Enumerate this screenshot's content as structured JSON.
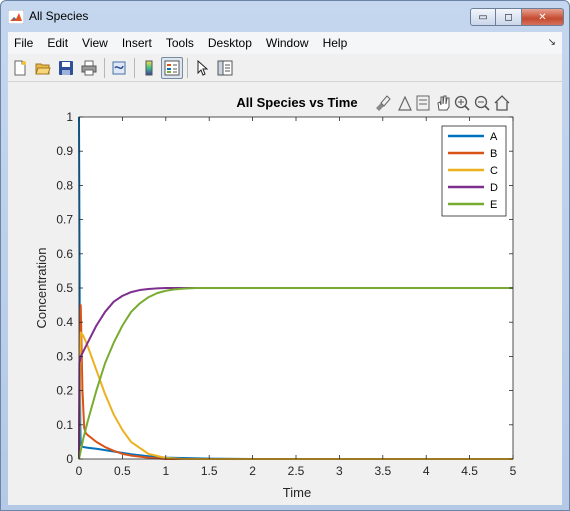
{
  "window": {
    "title": "All Species",
    "minimize_glyph": "▭",
    "maximize_glyph": "◻",
    "close_glyph": "✕"
  },
  "menu": {
    "items": [
      "File",
      "Edit",
      "View",
      "Insert",
      "Tools",
      "Desktop",
      "Window",
      "Help"
    ],
    "overflow_glyph": "↘"
  },
  "toolbar": {
    "buttons": [
      {
        "name": "new-figure-icon"
      },
      {
        "name": "open-file-icon"
      },
      {
        "name": "save-icon"
      },
      {
        "name": "print-icon"
      },
      {
        "name": "link-plot-icon"
      },
      {
        "name": "colorbar-icon"
      },
      {
        "name": "legend-icon",
        "pressed": true
      },
      {
        "name": "edit-plot-arrow-icon"
      },
      {
        "name": "property-inspector-icon"
      }
    ]
  },
  "axes_toolbar": {
    "icons": [
      "brush-icon",
      "data-cursor-icon",
      "export-icon",
      "pan-icon",
      "zoom-in-icon",
      "zoom-out-icon",
      "home-icon"
    ]
  },
  "chart_data": {
    "type": "line",
    "title": "All Species vs Time",
    "xlabel": "Time",
    "ylabel": "Concentration",
    "xlim": [
      0,
      5
    ],
    "ylim": [
      0,
      1
    ],
    "xticks": [
      "0",
      "0.5",
      "1",
      "1.5",
      "2",
      "2.5",
      "3",
      "3.5",
      "4",
      "4.5",
      "5"
    ],
    "yticks": [
      "0",
      "0.1",
      "0.2",
      "0.3",
      "0.4",
      "0.5",
      "0.6",
      "0.7",
      "0.8",
      "0.9",
      "1"
    ],
    "grid": false,
    "legend": "top-right",
    "series": [
      {
        "name": "A",
        "color": "#0072bd",
        "x": [
          0,
          0.005,
          0.01,
          0.015,
          0.02,
          0.05,
          0.1,
          0.2,
          0.4,
          0.6,
          0.8,
          1.0,
          1.5,
          2.0,
          2.15
        ],
        "y": [
          1.0,
          0.68,
          0.3,
          0.1,
          0.04,
          0.035,
          0.033,
          0.03,
          0.022,
          0.014,
          0.008,
          0.004,
          0.001,
          0.0,
          0.0
        ]
      },
      {
        "name": "B",
        "color": "#d95319",
        "x": [
          0,
          0.01,
          0.02,
          0.04,
          0.06,
          0.08,
          0.1,
          0.2,
          0.3,
          0.4,
          0.5,
          0.6,
          0.8,
          1.0,
          1.2
        ],
        "y": [
          0.0,
          0.3,
          0.45,
          0.2,
          0.09,
          0.075,
          0.07,
          0.05,
          0.035,
          0.024,
          0.015,
          0.01,
          0.004,
          0.0,
          0.0
        ]
      },
      {
        "name": "C",
        "color": "#edb120",
        "x": [
          0,
          0.02,
          0.05,
          0.1,
          0.2,
          0.3,
          0.4,
          0.5,
          0.6,
          0.8,
          1.0,
          1.2,
          5.0
        ],
        "y": [
          0.0,
          0.37,
          0.36,
          0.33,
          0.26,
          0.19,
          0.13,
          0.085,
          0.05,
          0.015,
          0.003,
          0.0,
          0.0
        ]
      },
      {
        "name": "D",
        "color": "#7e2f8e",
        "x": [
          0,
          0.005,
          0.02,
          0.05,
          0.1,
          0.2,
          0.3,
          0.4,
          0.5,
          0.6,
          0.7,
          0.8,
          0.9,
          1.0,
          1.2,
          5.0
        ],
        "y": [
          0.0,
          0.28,
          0.3,
          0.315,
          0.34,
          0.39,
          0.43,
          0.46,
          0.477,
          0.488,
          0.494,
          0.497,
          0.499,
          0.5,
          0.5,
          0.5
        ]
      },
      {
        "name": "E",
        "color": "#77ac30",
        "x": [
          0,
          0.05,
          0.1,
          0.2,
          0.3,
          0.4,
          0.5,
          0.6,
          0.7,
          0.8,
          0.9,
          1.0,
          1.1,
          1.2,
          1.35,
          1.5,
          5.0
        ],
        "y": [
          0.0,
          0.06,
          0.11,
          0.2,
          0.28,
          0.34,
          0.39,
          0.43,
          0.455,
          0.473,
          0.485,
          0.492,
          0.496,
          0.498,
          0.5,
          0.5,
          0.5
        ]
      }
    ]
  }
}
